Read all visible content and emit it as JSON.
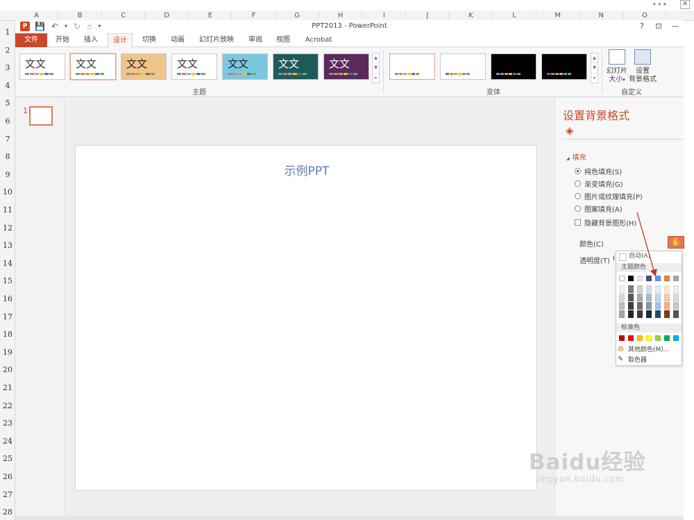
{
  "spreadsheet": {
    "columns": [
      "A",
      "B",
      "C",
      "D",
      "E",
      "F",
      "G",
      "H",
      "I",
      "J",
      "K",
      "L",
      "M",
      "N",
      "O"
    ],
    "rows": [
      "1",
      "2",
      "3",
      "4",
      "5",
      "6",
      "7",
      "8",
      "9",
      "10",
      "11",
      "12",
      "13",
      "14",
      "15",
      "16",
      "17",
      "18",
      "19",
      "20",
      "21",
      "22",
      "23",
      "24",
      "25",
      "26",
      "27",
      "28"
    ],
    "top_menu": "•••",
    "close_label": "✕"
  },
  "window": {
    "title": "PPT2013 - PowerPoint",
    "app_icon": "P",
    "qat": {
      "save_icon": "💾",
      "undo_icon": "↶",
      "undo_dd": "▾",
      "redo_icon": "↻",
      "touch_icon": "☝",
      "customize_icon": "▾"
    },
    "controls": {
      "help": "?",
      "ribbon_opts": "⊡",
      "minimize": "—"
    }
  },
  "tabs": [
    {
      "label": "文件"
    },
    {
      "label": "开始"
    },
    {
      "label": "插入"
    },
    {
      "label": "设计"
    },
    {
      "label": "切换"
    },
    {
      "label": "动画"
    },
    {
      "label": "幻灯片放映"
    },
    {
      "label": "审阅"
    },
    {
      "label": "视图"
    },
    {
      "label": "Acrobat"
    }
  ],
  "ribbon": {
    "themes": [
      {
        "text": "文文",
        "bg": "#ffffff",
        "fg": "#333333"
      },
      {
        "text": "文文",
        "bg": "#ffffff",
        "fg": "#333333"
      },
      {
        "text": "文文",
        "bg": "#f0c48a",
        "fg": "#222222"
      },
      {
        "text": "文文",
        "bg": "#ffffff",
        "fg": "#333333"
      },
      {
        "text": "文文",
        "bg": "#7cc7e0",
        "fg": "#222222"
      },
      {
        "text": "文文",
        "bg": "#1f5a5a",
        "fg": "#ffffff"
      },
      {
        "text": "文文",
        "bg": "#5a2a5a",
        "fg": "#ffffff"
      }
    ],
    "themes_group": "主题",
    "variants_group": "变体",
    "custom_group": "自定义",
    "slide_size": "幻灯片\n大小",
    "slide_size_dd": "▾",
    "format_bg": "设置\n背景格式",
    "scroll": {
      "up": "▲",
      "down": "▼",
      "more": "▾"
    }
  },
  "slides": {
    "number": "1",
    "title": "示例PPT"
  },
  "pane": {
    "title": "设置背景格式",
    "icon": "◈",
    "section": "填充",
    "section_arrow": "◢",
    "options": [
      {
        "label": "纯色填充(S)",
        "checked": true
      },
      {
        "label": "渐变填充(G)",
        "checked": false
      },
      {
        "label": "图片或纹理填充(P)",
        "checked": false
      },
      {
        "label": "图案填充(A)",
        "checked": false
      }
    ],
    "hide_bg": "隐藏背景图形(H)",
    "color_label": "颜色(C)",
    "color_icon": "✋",
    "transparency_label": "透明度(T)",
    "transparency_value": "I"
  },
  "color_dropdown": {
    "auto": "自动(A)",
    "theme_colors_label": "主题颜色",
    "standard_colors_label": "标准色",
    "more_colors": "其他颜色(M)...",
    "more_colors_icon": "◍",
    "eyedropper": "取色器",
    "eyedropper_icon": "✎",
    "theme_row": [
      "#ffffff",
      "#000000",
      "#e7e6e6",
      "#44546a",
      "#5b9bd5",
      "#ed7d31",
      "#a5a5a5"
    ],
    "shades": [
      [
        "#f2f2f2",
        "#d9d9d9",
        "#bfbfbf",
        "#a6a6a6"
      ],
      [
        "#808080",
        "#595959",
        "#404040",
        "#262626"
      ],
      [
        "#d0cece",
        "#aeabab",
        "#757171",
        "#3a3838"
      ],
      [
        "#d6dce4",
        "#adb9ca",
        "#8497b0",
        "#222a35"
      ],
      [
        "#deebf6",
        "#bdd7ee",
        "#9dc3e6",
        "#1f4e79"
      ],
      [
        "#fbe5d5",
        "#f7cbac",
        "#f4b183",
        "#843c0c"
      ],
      [
        "#ededed",
        "#dbdbdb",
        "#c9c9c9",
        "#525252"
      ]
    ],
    "standard": [
      "#c00000",
      "#ff0000",
      "#ffc000",
      "#ffff00",
      "#92d050",
      "#00b050",
      "#00b0f0"
    ]
  },
  "watermark": {
    "main": "Baidu经验",
    "url": "jingyan.baidu.com"
  }
}
